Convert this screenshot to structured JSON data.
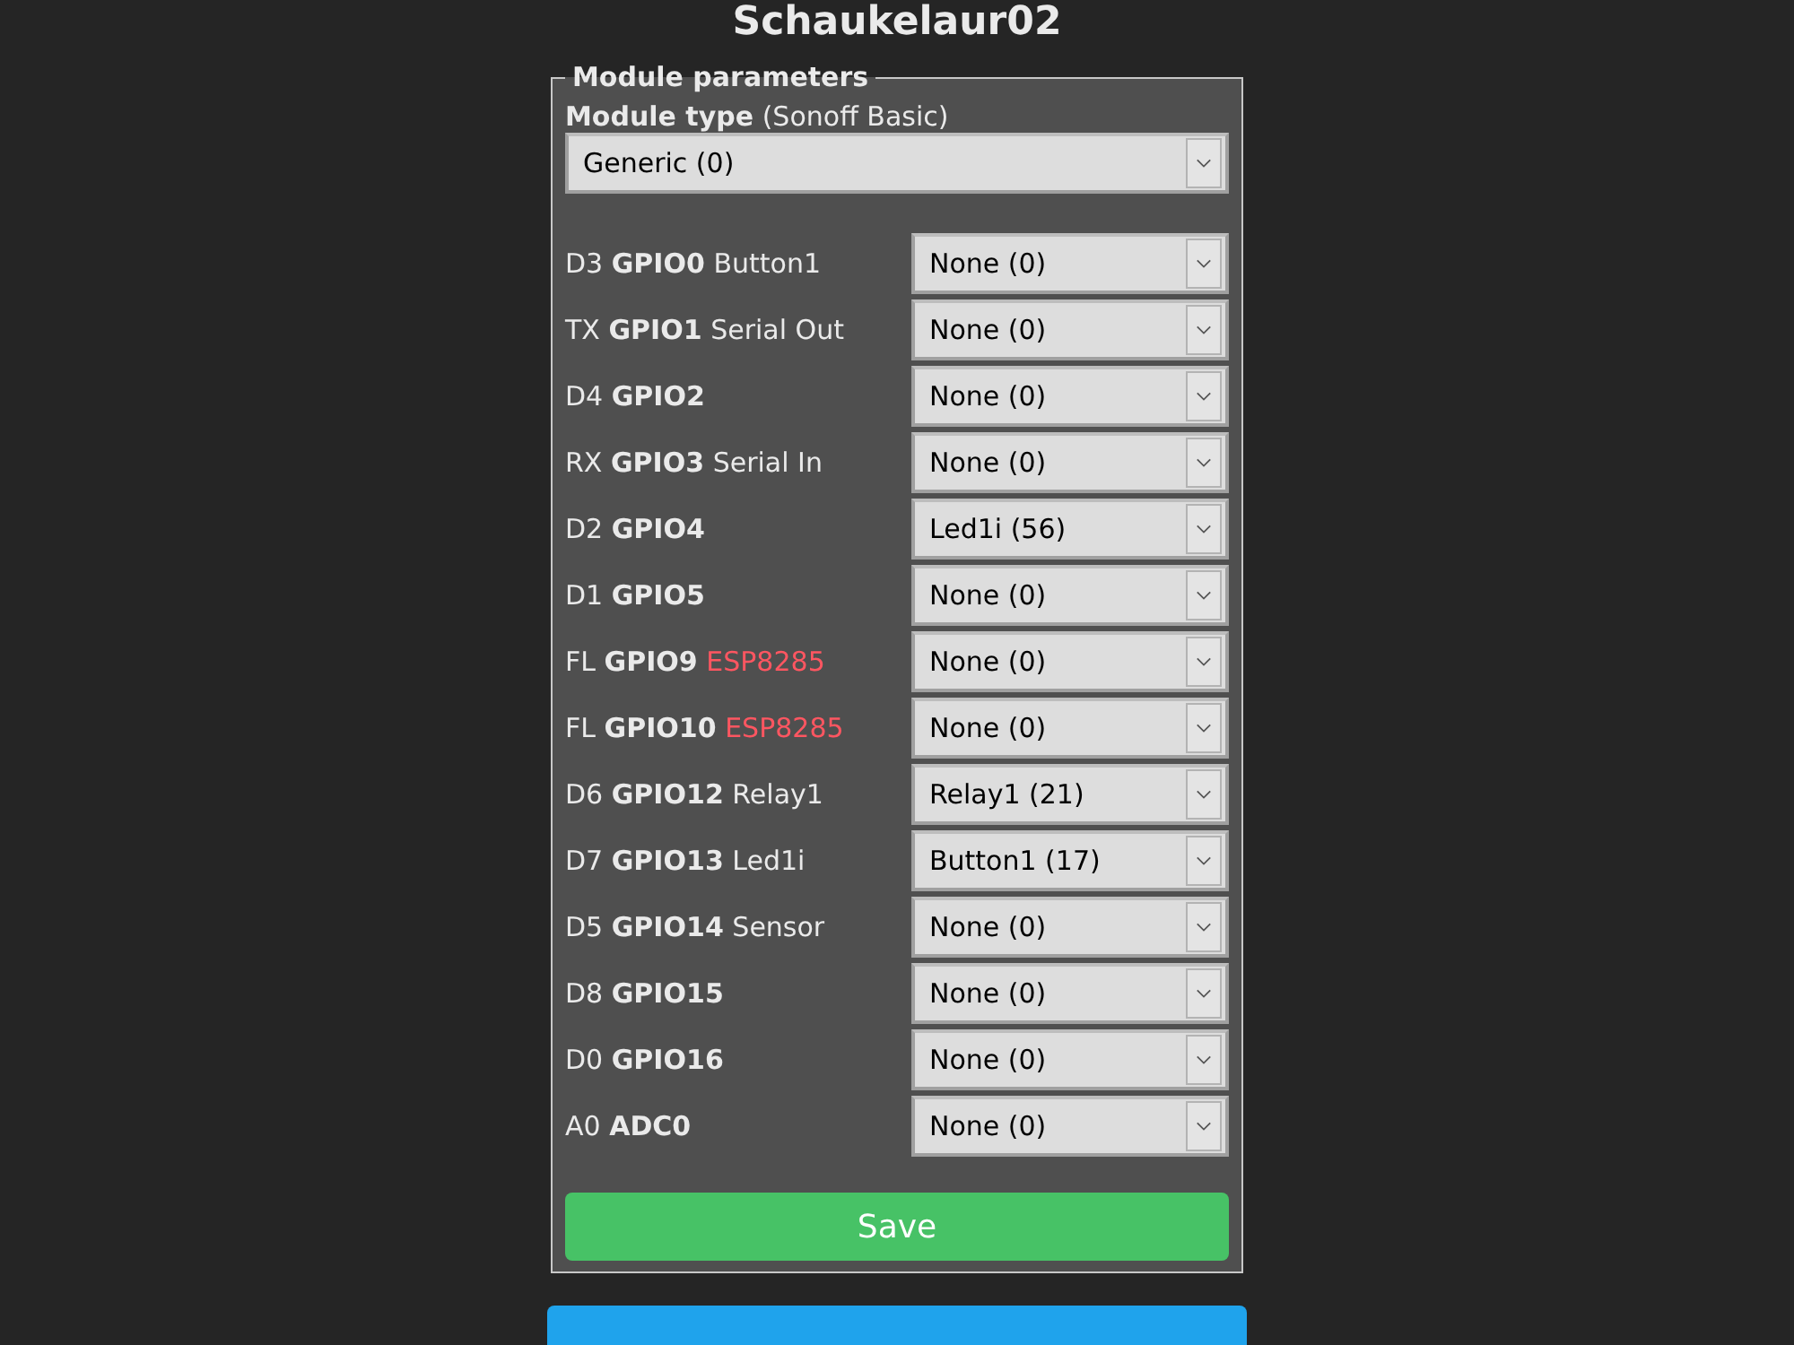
{
  "page_title": "Schaukelaur02",
  "fieldset": {
    "legend": "Module parameters",
    "module_type": {
      "label": "Module type",
      "note": "(Sonoff Basic)",
      "value": "Generic (0)"
    },
    "pins": [
      {
        "pin": "D3",
        "gpio": "GPIO0",
        "note": "Button1",
        "kind": "normal",
        "value": "None (0)"
      },
      {
        "pin": "TX",
        "gpio": "GPIO1",
        "note": "Serial Out",
        "kind": "normal",
        "value": "None (0)"
      },
      {
        "pin": "D4",
        "gpio": "GPIO2",
        "value": "None (0)"
      },
      {
        "pin": "RX",
        "gpio": "GPIO3",
        "note": "Serial In",
        "kind": "normal",
        "value": "None (0)"
      },
      {
        "pin": "D2",
        "gpio": "GPIO4",
        "value": "Led1i (56)"
      },
      {
        "pin": "D1",
        "gpio": "GPIO5",
        "value": "None (0)"
      },
      {
        "pin": "FL",
        "gpio": "GPIO9",
        "note": "ESP8285",
        "kind": "warning",
        "value": "None (0)"
      },
      {
        "pin": "FL",
        "gpio": "GPIO10",
        "note": "ESP8285",
        "kind": "warning",
        "value": "None (0)"
      },
      {
        "pin": "D6",
        "gpio": "GPIO12",
        "note": "Relay1",
        "kind": "normal",
        "value": "Relay1 (21)"
      },
      {
        "pin": "D7",
        "gpio": "GPIO13",
        "note": "Led1i",
        "kind": "normal",
        "value": "Button1 (17)"
      },
      {
        "pin": "D5",
        "gpio": "GPIO14",
        "note": "Sensor",
        "kind": "normal",
        "value": "None (0)"
      },
      {
        "pin": "D8",
        "gpio": "GPIO15",
        "value": "None (0)"
      },
      {
        "pin": "D0",
        "gpio": "GPIO16",
        "value": "None (0)"
      },
      {
        "pin": "A0",
        "gpio": "ADC0",
        "value": "None (0)"
      }
    ],
    "save_button": "Save"
  }
}
